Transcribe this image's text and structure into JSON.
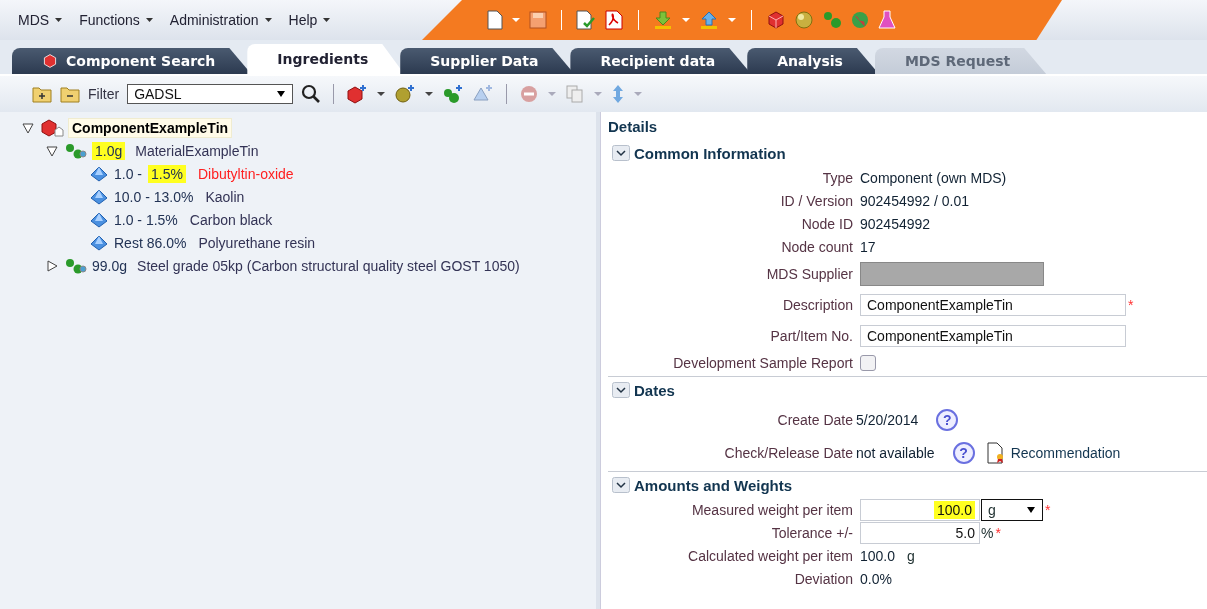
{
  "menu": [
    {
      "label": "MDS"
    },
    {
      "label": "Functions"
    },
    {
      "label": "Administration"
    },
    {
      "label": "Help"
    }
  ],
  "tabs": [
    {
      "label": "Component Search",
      "selected": false,
      "disabled": false,
      "icon": true
    },
    {
      "label": "Ingredients",
      "selected": true,
      "disabled": false,
      "icon": false
    },
    {
      "label": "Supplier Data",
      "selected": false,
      "disabled": false,
      "icon": false
    },
    {
      "label": "Recipient data",
      "selected": false,
      "disabled": false,
      "icon": false
    },
    {
      "label": "Analysis",
      "selected": false,
      "disabled": false,
      "icon": false
    },
    {
      "label": "MDS Request",
      "selected": false,
      "disabled": true,
      "icon": false
    }
  ],
  "toolbar": {
    "filter_label": "Filter",
    "filter_value": "GADSL"
  },
  "tree": [
    {
      "label": "ComponentExampleTin",
      "selected": true,
      "expanded": true,
      "children": [
        {
          "label": "MaterialExampleTin",
          "expanded": true,
          "parts": [
            {
              "text": "1.0g",
              "highlighted": true
            }
          ],
          "children": [
            {
              "label": "Dibutyltin-oxide",
              "color": "#ff2020",
              "parts": [
                {
                  "text": "1.0 -",
                  "highlighted": false
                },
                {
                  "text": "1.5%",
                  "highlighted": true
                }
              ]
            },
            {
              "label": "Kaolin",
              "color": "#333355",
              "parts": [
                {
                  "text": "10.0 - 13.0%",
                  "highlighted": false
                }
              ]
            },
            {
              "label": "Carbon black",
              "color": "#333355",
              "parts": [
                {
                  "text": "1.0 - 1.5%",
                  "highlighted": false
                }
              ]
            },
            {
              "label": "Polyurethane resin",
              "color": "#333355",
              "parts": [
                {
                  "text": "Rest  86.0%",
                  "highlighted": false
                }
              ]
            }
          ]
        },
        {
          "label": "Steel grade 05kp (Carbon structural quality steel GOST 1050)",
          "expanded": false,
          "parts": [
            {
              "text": "99.0g",
              "highlighted": false
            }
          ]
        }
      ]
    }
  ],
  "details": {
    "title": "Details",
    "sections": [
      {
        "title": "Common Information",
        "expanded": true,
        "rows": [
          {
            "kind": "text",
            "label": "Type",
            "value": "Component (own MDS)"
          },
          {
            "kind": "text",
            "label": "ID / Version",
            "value": "902454992 / 0.01"
          },
          {
            "kind": "text",
            "label": "Node ID",
            "value": "902454992"
          },
          {
            "kind": "text",
            "label": "Node count",
            "value": "17"
          },
          {
            "kind": "redacted",
            "label": "MDS Supplier"
          },
          {
            "kind": "input",
            "label": "Description",
            "value": "ComponentExampleTin",
            "required_mark": "*"
          },
          {
            "kind": "input",
            "label": "Part/Item No.",
            "value": "ComponentExampleTin"
          },
          {
            "kind": "checkbox",
            "label": "Development Sample Report",
            "checked": false
          }
        ]
      },
      {
        "title": "Dates",
        "expanded": true,
        "rows": [
          {
            "kind": "help",
            "label": "Create Date",
            "value": "5/20/2014",
            "help": "?"
          },
          {
            "kind": "help",
            "label": "Check/Release Date",
            "value": "not available",
            "help": "?",
            "link": "Recommendation"
          }
        ]
      },
      {
        "title": "Amounts and Weights",
        "expanded": true,
        "rows": [
          {
            "kind": "weight",
            "label": "Measured weight per item",
            "value": "100.0",
            "highlighted": true,
            "unit": "g",
            "required_mark": "*"
          },
          {
            "kind": "number",
            "label": "Tolerance +/-",
            "value": "5.0",
            "unit": "%",
            "required_mark": "*"
          },
          {
            "kind": "text",
            "label": "Calculated weight per item",
            "value": "100.0",
            "unit": "g"
          },
          {
            "kind": "text",
            "label": "Deviation",
            "value": "0.0%"
          }
        ]
      }
    ]
  }
}
